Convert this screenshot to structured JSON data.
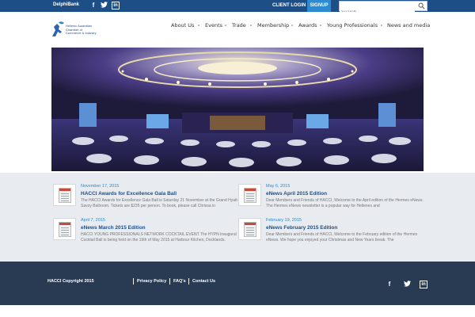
{
  "topbar": {
    "delphi_logo": "DelphiBank",
    "social": [
      "f",
      "t",
      "in"
    ],
    "client_login": "CLIENT LOGIN",
    "signup": "SIGNUP",
    "search_placeholder": "Search"
  },
  "brand": {
    "line1": "Hellenic Australian",
    "line2": "Chamber of",
    "line3": "Commerce & Industry"
  },
  "nav": {
    "items": [
      "About Us",
      "Events",
      "Trade",
      "Membership",
      "Awards",
      "Young Professionals",
      "News and media"
    ]
  },
  "news": [
    {
      "date": "November 17, 2015",
      "title": "HACCI Awards for Excellence Gala Ball",
      "body": "The HACCI Awards for Excellence Gala Ball is Saturday 21 November at the Grand Hyatt Savoy Ballroom. Tickets are $235 per person. To book, please call Chrissa in"
    },
    {
      "date": "May 6, 2015",
      "title": "eNews April 2015 Edition",
      "body": "Dear Members and Friends of HACCI, Welcome to the April edition of the Hermes eNews. The Hermes eNews newsletter is a popular way for Hellenes and"
    },
    {
      "date": "April 7, 2015",
      "title": "eNews March 2015 Edition",
      "body": "HACCI YOUNG PROFESSIONALS NETWORK COCKTAIL EVENT The HYPN inaugural Cocktail Ball is being held on the 19th of May 2015 at Harbour Kitchen, Docklands."
    },
    {
      "date": "February 19, 2015",
      "title": "eNews February 2015 Edition",
      "body": "Dear Members and Friends of HACCI, Welcome to the February edition of the Hermes eNews. We hope you enjoyed your Christmas and New Years break. The"
    }
  ],
  "footer": {
    "copyright": "HACCI Copyright 2015",
    "links": [
      "Privacy Policy",
      "FAQ's",
      "Contact Us"
    ],
    "social": [
      "f",
      "t",
      "in"
    ]
  },
  "colors": {
    "topbar": "#1d4f86",
    "accent": "#2c8ad0",
    "footer": "#283b52",
    "news_band": "#e8ebef"
  }
}
